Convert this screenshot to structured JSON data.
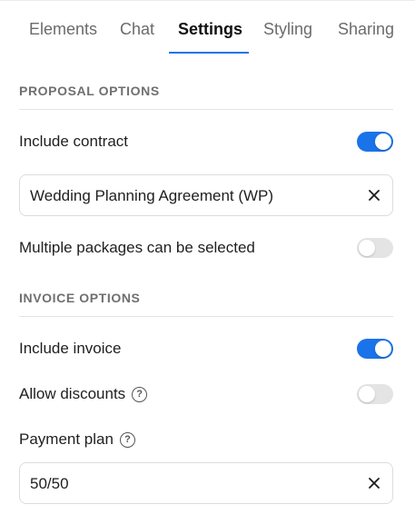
{
  "tabs": [
    {
      "label": "Elements",
      "active": false
    },
    {
      "label": "Chat",
      "active": false
    },
    {
      "label": "Settings",
      "active": true
    },
    {
      "label": "Styling",
      "active": false
    },
    {
      "label": "Sharing",
      "active": false
    }
  ],
  "proposal_options": {
    "title": "PROPOSAL OPTIONS",
    "include_contract": {
      "label": "Include contract",
      "enabled": true
    },
    "contract_select": {
      "value": "Wedding Planning Agreement (WP)"
    },
    "multiple_packages": {
      "label": "Multiple packages can be selected",
      "enabled": false
    }
  },
  "invoice_options": {
    "title": "INVOICE OPTIONS",
    "include_invoice": {
      "label": "Include invoice",
      "enabled": true
    },
    "allow_discounts": {
      "label": "Allow discounts",
      "enabled": false
    },
    "payment_plan": {
      "label": "Payment plan",
      "value": "50/50"
    }
  },
  "icons": {
    "help": "question-circle-icon",
    "clear": "close-icon"
  },
  "colors": {
    "accent": "#1a73e8",
    "toggle_off": "#e4e4e4",
    "section_title": "#6f6f6f"
  }
}
